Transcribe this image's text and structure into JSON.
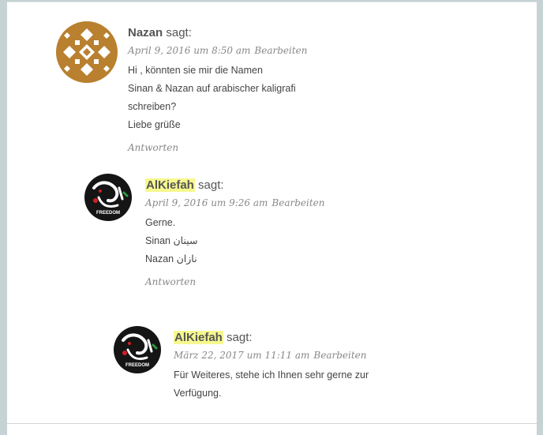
{
  "comments": [
    {
      "author": "Nazan",
      "says": "sagt:",
      "date": "April 9, 2016 um 8:50 am",
      "edit": "Bearbeiten",
      "lines": [
        "Hi , könnten sie mir die Namen",
        "Sinan & Nazan auf arabischer kaligrafi schreiben?",
        "Liebe grüße"
      ],
      "reply": "Antworten"
    },
    {
      "author": "AlKiefah",
      "says": "sagt:",
      "date": "April 9, 2016 um 9:26 am",
      "edit": "Bearbeiten",
      "lines": [
        "Gerne.",
        "Sinan سينان",
        "Nazan نازان"
      ],
      "reply": "Antworten"
    },
    {
      "author": "AlKiefah",
      "says": "sagt:",
      "date": "März 22, 2017 um 11:11 am",
      "edit": "Bearbeiten",
      "lines": [
        "Für Weiteres, stehe ich Ihnen sehr gerne zur Verfügung."
      ]
    }
  ],
  "avatar_badge": "FREEDOM",
  "colors": {
    "highlight": "#f6f88f",
    "avatar_gold": "#b8802f",
    "meta_gray": "#888888"
  }
}
